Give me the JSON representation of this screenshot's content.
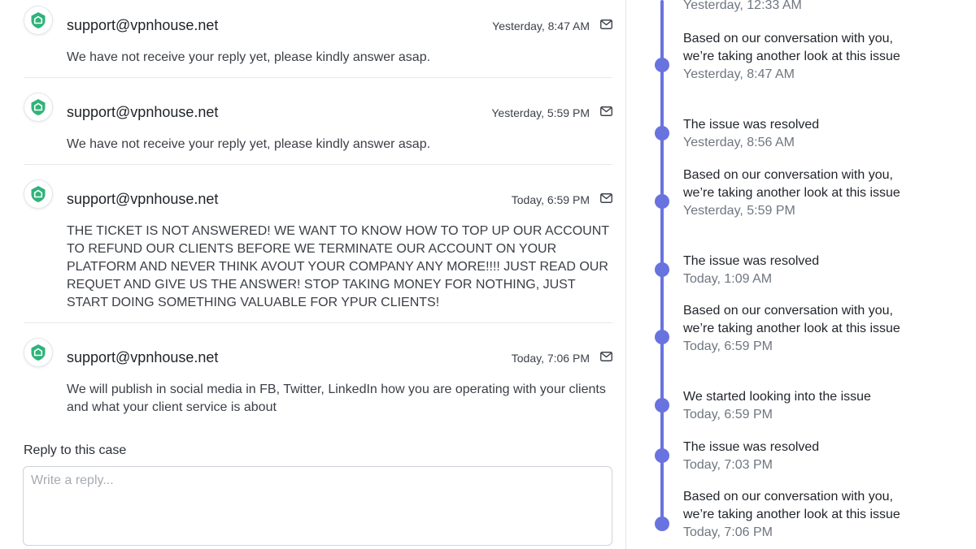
{
  "messages": [
    {
      "sender": "support@vpnhouse.net",
      "time": "Yesterday, 8:47 AM",
      "body": "We have not receive your reply yet, please kindly answer asap."
    },
    {
      "sender": "support@vpnhouse.net",
      "time": "Yesterday, 5:59 PM",
      "body": "We have not receive your reply yet, please kindly answer asap."
    },
    {
      "sender": "support@vpnhouse.net",
      "time": "Today, 6:59 PM",
      "body": "THE TICKET IS NOT ANSWERED! WE WANT TO KNOW HOW TO TOP UP OUR ACCOUNT TO REFUND OUR CLIENTS BEFORE WE TERMINATE OUR ACCOUNT ON YOUR PLATFORM AND NEVER THINK AVOUT YOUR COMPANY ANY MORE!!!! JUST READ OUR REQUET AND GIVE US THE ANSWER! STOP TAKING MONEY FOR NOTHING, JUST START DOING SOMETHING VALUABLE FOR YPUR CLIENTS!"
    },
    {
      "sender": "support@vpnhouse.net",
      "time": "Today, 7:06 PM",
      "body": "We will publish in social media in FB, Twitter, LinkedIn how you are operating with your clients and what your client service is about"
    }
  ],
  "reply": {
    "label": "Reply to this case",
    "placeholder": "Write a reply..."
  },
  "timeline": [
    {
      "text": "",
      "time": "Yesterday, 12:33 AM"
    },
    {
      "text": "Based on our conversation with you, we’re taking another look at this issue",
      "time": "Yesterday, 8:47 AM"
    },
    {
      "text": "The issue was resolved",
      "time": "Yesterday, 8:56 AM"
    },
    {
      "text": "Based on our conversation with you, we’re taking another look at this issue",
      "time": "Yesterday, 5:59 PM"
    },
    {
      "text": "The issue was resolved",
      "time": "Today, 1:09 AM"
    },
    {
      "text": "Based on our conversation with you, we’re taking another look at this issue",
      "time": "Today, 6:59 PM"
    },
    {
      "text": "We started looking into the issue",
      "time": "Today, 6:59 PM"
    },
    {
      "text": "The issue was resolved",
      "time": "Today, 7:03 PM"
    },
    {
      "text": "Based on our conversation with you, we’re taking another look at this issue",
      "time": "Today, 7:06 PM"
    }
  ],
  "icons": {
    "avatar": "shield-logo-icon",
    "message_action": "mail-icon"
  },
  "colors": {
    "accent": "#6973df",
    "avatar_green": "#2fb37a"
  }
}
